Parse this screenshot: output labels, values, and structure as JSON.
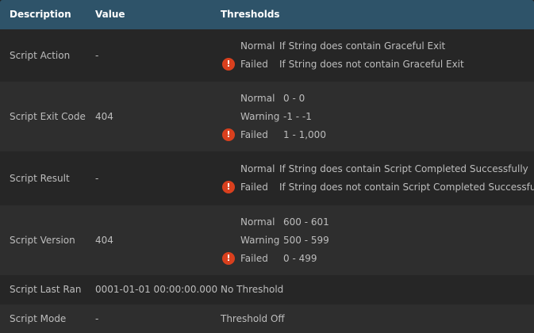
{
  "headers": {
    "description": "Description",
    "value": "Value",
    "thresholds": "Thresholds"
  },
  "rows": [
    {
      "description": "Script Action",
      "value": "-",
      "thresholds": [
        {
          "level": "Normal",
          "condition": "If String does contain Graceful Exit",
          "icon": ""
        },
        {
          "level": "Failed",
          "condition": "If String does not contain Graceful Exit",
          "icon": "!"
        }
      ]
    },
    {
      "description": "Script Exit Code",
      "value": "404",
      "thresholds": [
        {
          "level": "Normal",
          "condition": "0 - 0",
          "icon": ""
        },
        {
          "level": "Warning",
          "condition": "-1 - -1",
          "icon": ""
        },
        {
          "level": "Failed",
          "condition": "1 - 1,000",
          "icon": "!"
        }
      ]
    },
    {
      "description": "Script Result",
      "value": "-",
      "thresholds": [
        {
          "level": "Normal",
          "condition": "If String does contain Script Completed Successfully",
          "icon": ""
        },
        {
          "level": "Failed",
          "condition": "If String does not contain Script Completed Successfully",
          "icon": "!"
        }
      ]
    },
    {
      "description": "Script Version",
      "value": "404",
      "thresholds": [
        {
          "level": "Normal",
          "condition": "600 - 601",
          "icon": ""
        },
        {
          "level": "Warning",
          "condition": "500 - 599",
          "icon": ""
        },
        {
          "level": "Failed",
          "condition": "0 - 499",
          "icon": "!"
        }
      ]
    },
    {
      "description": "Script Last Ran",
      "value": "0001-01-01 00:00:00.000",
      "threshold_text": "No Threshold"
    },
    {
      "description": "Script Mode",
      "value": "-",
      "threshold_text": "Threshold Off"
    }
  ],
  "colors": {
    "header": "#2e5369",
    "failed_icon": "#d9401e"
  }
}
